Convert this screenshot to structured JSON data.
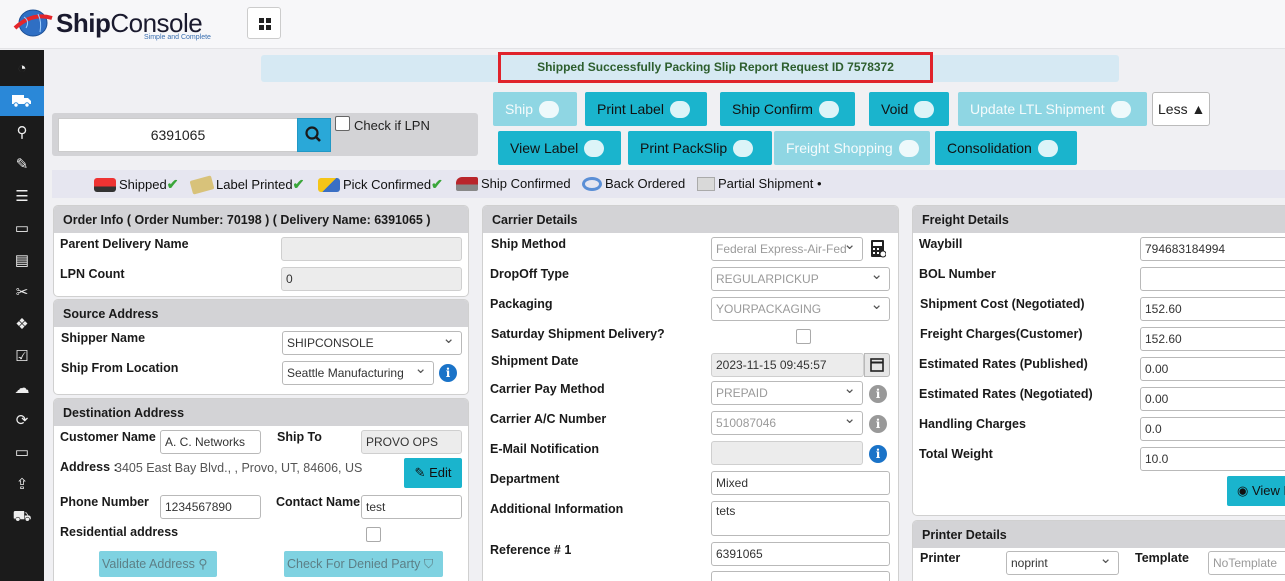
{
  "app": {
    "name": "ShipConsole",
    "tagline": "Simple and Complete",
    "logo_part1": "Ship",
    "logo_part2": "Console"
  },
  "sidebar": {
    "icons": [
      "dashboard-icon",
      "truck-icon",
      "map-marker-icon",
      "edit-icon",
      "list-icon",
      "folder-open-icon",
      "id-card-icon",
      "wrench-icon",
      "dropbox-icon",
      "check-square-icon",
      "cloud-upload-icon",
      "refresh-icon",
      "folder-icon",
      "upload-icon",
      "cart-icon"
    ],
    "active_index": 1,
    "active_color": "#2a88d8"
  },
  "status": {
    "message": "Shipped Successfully Packing Slip Report Request ID 7578372"
  },
  "search": {
    "value": "6391065",
    "lpn_label": "Check if LPN"
  },
  "actions": {
    "ship": "Ship",
    "print_label": "Print Label",
    "ship_confirm": "Ship Confirm",
    "void": "Void",
    "update_ltl": "Update LTL Shipment",
    "less": "Less",
    "view_label": "View Label",
    "print_packslip": "Print PackSlip",
    "freight_shopping": "Freight Shopping",
    "consolidation": "Consolidation"
  },
  "legend": {
    "shipped": "Shipped",
    "label_printed": "Label Printed",
    "pick_confirmed": "Pick Confirmed",
    "ship_confirmed": "Ship Confirmed",
    "back_ordered": "Back Ordered",
    "partial_shipment": "Partial Shipment",
    "check_color": "#3aa63a"
  },
  "order_info": {
    "title": "Order Info ( Order Number: 70198 ) ( Delivery Name: 6391065 )",
    "parent_delivery_label": "Parent Delivery Name",
    "parent_delivery_value": "",
    "lpn_count_label": "LPN Count",
    "lpn_count_value": "0"
  },
  "source": {
    "title": "Source Address",
    "shipper_label": "Shipper Name",
    "shipper_value": "SHIPCONSOLE",
    "from_label": "Ship From Location",
    "from_value": "Seattle Manufacturing"
  },
  "destination": {
    "title": "Destination Address",
    "customer_label": "Customer Name",
    "customer_value": "A. C. Networks",
    "ship_to_label": "Ship To",
    "ship_to_value": "PROVO OPS",
    "address_label": "Address :",
    "address_value": "3405 East Bay Blvd., , Provo, UT, 84606, US",
    "edit": "Edit",
    "phone_label": "Phone Number",
    "phone_value": "1234567890",
    "contact_label": "Contact Name",
    "contact_value": "test",
    "residential_label": "Residential address",
    "validate": "Validate Address",
    "denied": "Check For Denied Party"
  },
  "carrier": {
    "title": "Carrier Details",
    "ship_method_label": "Ship Method",
    "ship_method_value": "Federal Express-Air-Fed",
    "dropoff_label": "DropOff Type",
    "dropoff_value": "REGULARPICKUP",
    "packaging_label": "Packaging",
    "packaging_value": "YOURPACKAGING",
    "saturday_label": "Saturday Shipment Delivery?",
    "shipment_date_label": "Shipment Date",
    "shipment_date_value": "2023-11-15 09:45:57",
    "pay_method_label": "Carrier Pay Method",
    "pay_method_value": "PREPAID",
    "account_label": "Carrier A/C Number",
    "account_value": "510087046",
    "email_label": "E-Mail Notification",
    "email_value": "",
    "department_label": "Department",
    "department_value": "Mixed",
    "additional_label": "Additional Information",
    "additional_value": "tets",
    "reference_label": "Reference # 1",
    "reference_value": "6391065"
  },
  "freight": {
    "title": "Freight Details",
    "waybill_label": "Waybill",
    "waybill_value": "794683184994",
    "bol_label": "BOL Number",
    "bol_value": "",
    "cost_label": "Shipment Cost (Negotiated)",
    "cost_value": "152.60",
    "charges_label": "Freight Charges(Customer)",
    "charges_value": "152.60",
    "est_pub_label": "Estimated Rates (Published)",
    "est_pub_value": "0.00",
    "est_neg_label": "Estimated Rates (Negotiated)",
    "est_neg_value": "0.00",
    "handling_label": "Handling Charges",
    "handling_value": "0.0",
    "weight_label": "Total Weight",
    "weight_value": "10.0",
    "view": "View N"
  },
  "printer": {
    "title": "Printer Details",
    "printer_label": "Printer",
    "printer_value": "noprint",
    "template_label": "Template",
    "template_placeholder": "NoTemplate"
  }
}
